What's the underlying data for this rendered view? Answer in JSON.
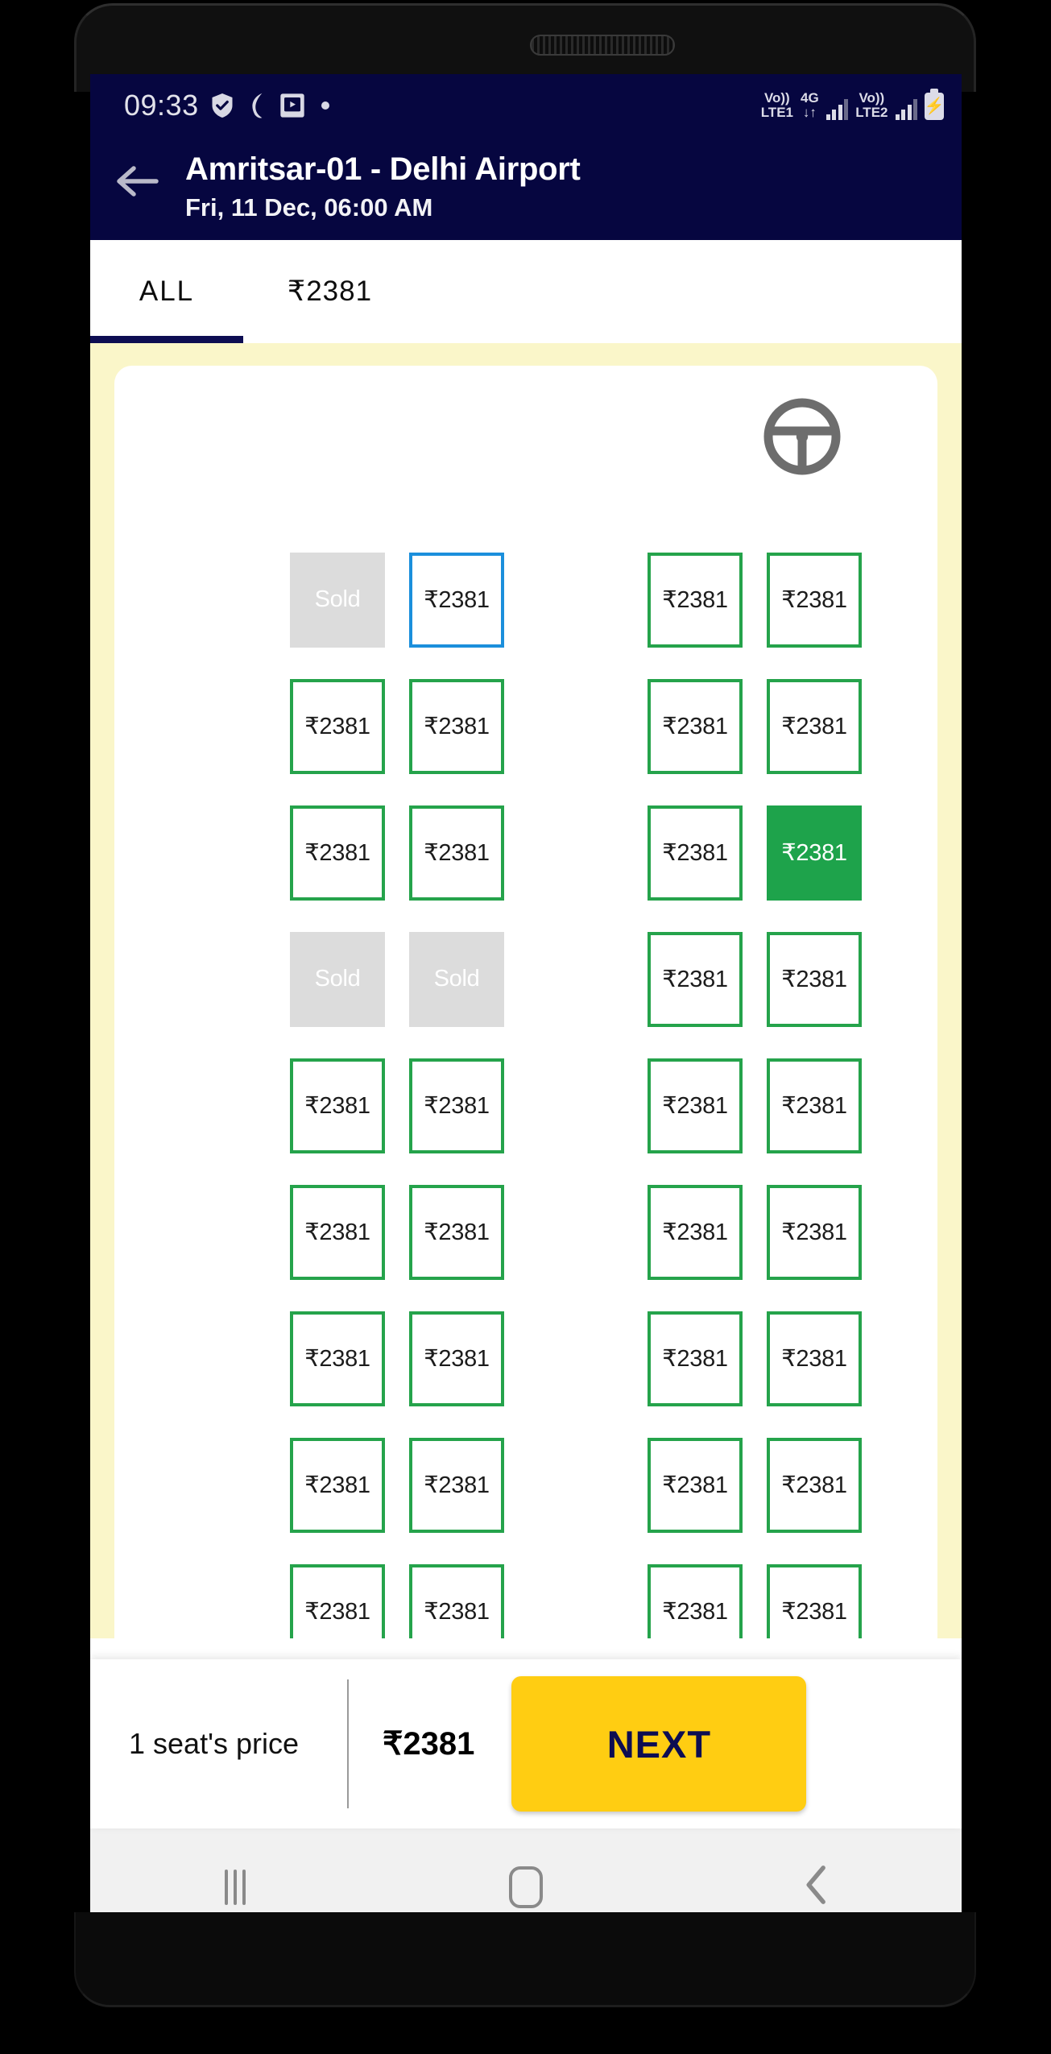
{
  "status_bar": {
    "clock": "09:33",
    "left_icons": [
      "shield-icon",
      "moon-icon",
      "screenshot-icon",
      "dot-icon"
    ],
    "sim1_label_top": "Vo))",
    "sim1_label_bottom": "LTE1",
    "network_type": "4G",
    "data_arrows": "↓↑",
    "sim2_label_top": "Vo))",
    "sim2_label_bottom": "LTE2",
    "battery_glyph": "⚡"
  },
  "app_bar": {
    "back_icon": "arrow-left-icon",
    "title": "Amritsar-01 - Delhi Airport",
    "subtitle": "Fri, 11 Dec,  06:00 AM",
    "background_color": "#060640"
  },
  "tabs": [
    {
      "label": "ALL",
      "active": true
    },
    {
      "label": "₹2381",
      "active": false
    }
  ],
  "seat_map": {
    "deck_icon": "steering-wheel-icon",
    "background_color": "#FAF6C9",
    "card_color": "#FFFFFF",
    "legend_colors": {
      "available": "#25A34B",
      "selected": "#1EA34B",
      "highlight": "#1B8FDC",
      "sold": "#DCDCDC"
    },
    "sold_label": "Sold",
    "price_label": "₹2381",
    "rows": [
      [
        "sold",
        "highlight",
        "aisle",
        "available",
        "available"
      ],
      [
        "available",
        "available",
        "aisle",
        "available",
        "available"
      ],
      [
        "available",
        "available",
        "aisle",
        "available",
        "selected"
      ],
      [
        "sold",
        "sold",
        "aisle",
        "available",
        "available"
      ],
      [
        "available",
        "available",
        "aisle",
        "available",
        "available"
      ],
      [
        "available",
        "available",
        "aisle",
        "available",
        "available"
      ],
      [
        "available",
        "available",
        "aisle",
        "available",
        "available"
      ],
      [
        "available",
        "available",
        "aisle",
        "available",
        "available"
      ],
      [
        "available",
        "available",
        "aisle",
        "available",
        "available"
      ]
    ]
  },
  "bottom_bar": {
    "seat_count_label": "1 seat's price",
    "total_price": "₹2381",
    "next_label": "NEXT",
    "next_color": "#FFCD12"
  },
  "nav_bar": {
    "recents": "recents-icon",
    "home": "home-icon",
    "back": "back-chevron-icon"
  }
}
